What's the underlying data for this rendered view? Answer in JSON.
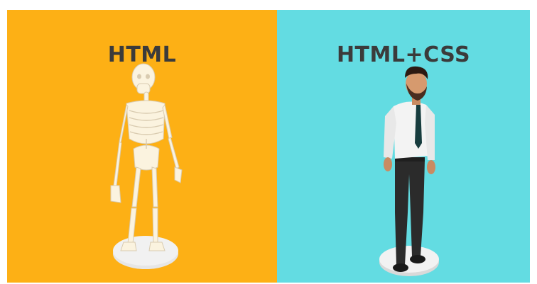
{
  "colors": {
    "left_background": "#FDB015",
    "right_background": "#63DCE2",
    "title_color": "#3B3B3B"
  },
  "left_panel": {
    "title": "HTML",
    "figure": "skeleton-illustration"
  },
  "right_panel": {
    "title": "HTML+CSS",
    "figure": "businessman-illustration"
  }
}
